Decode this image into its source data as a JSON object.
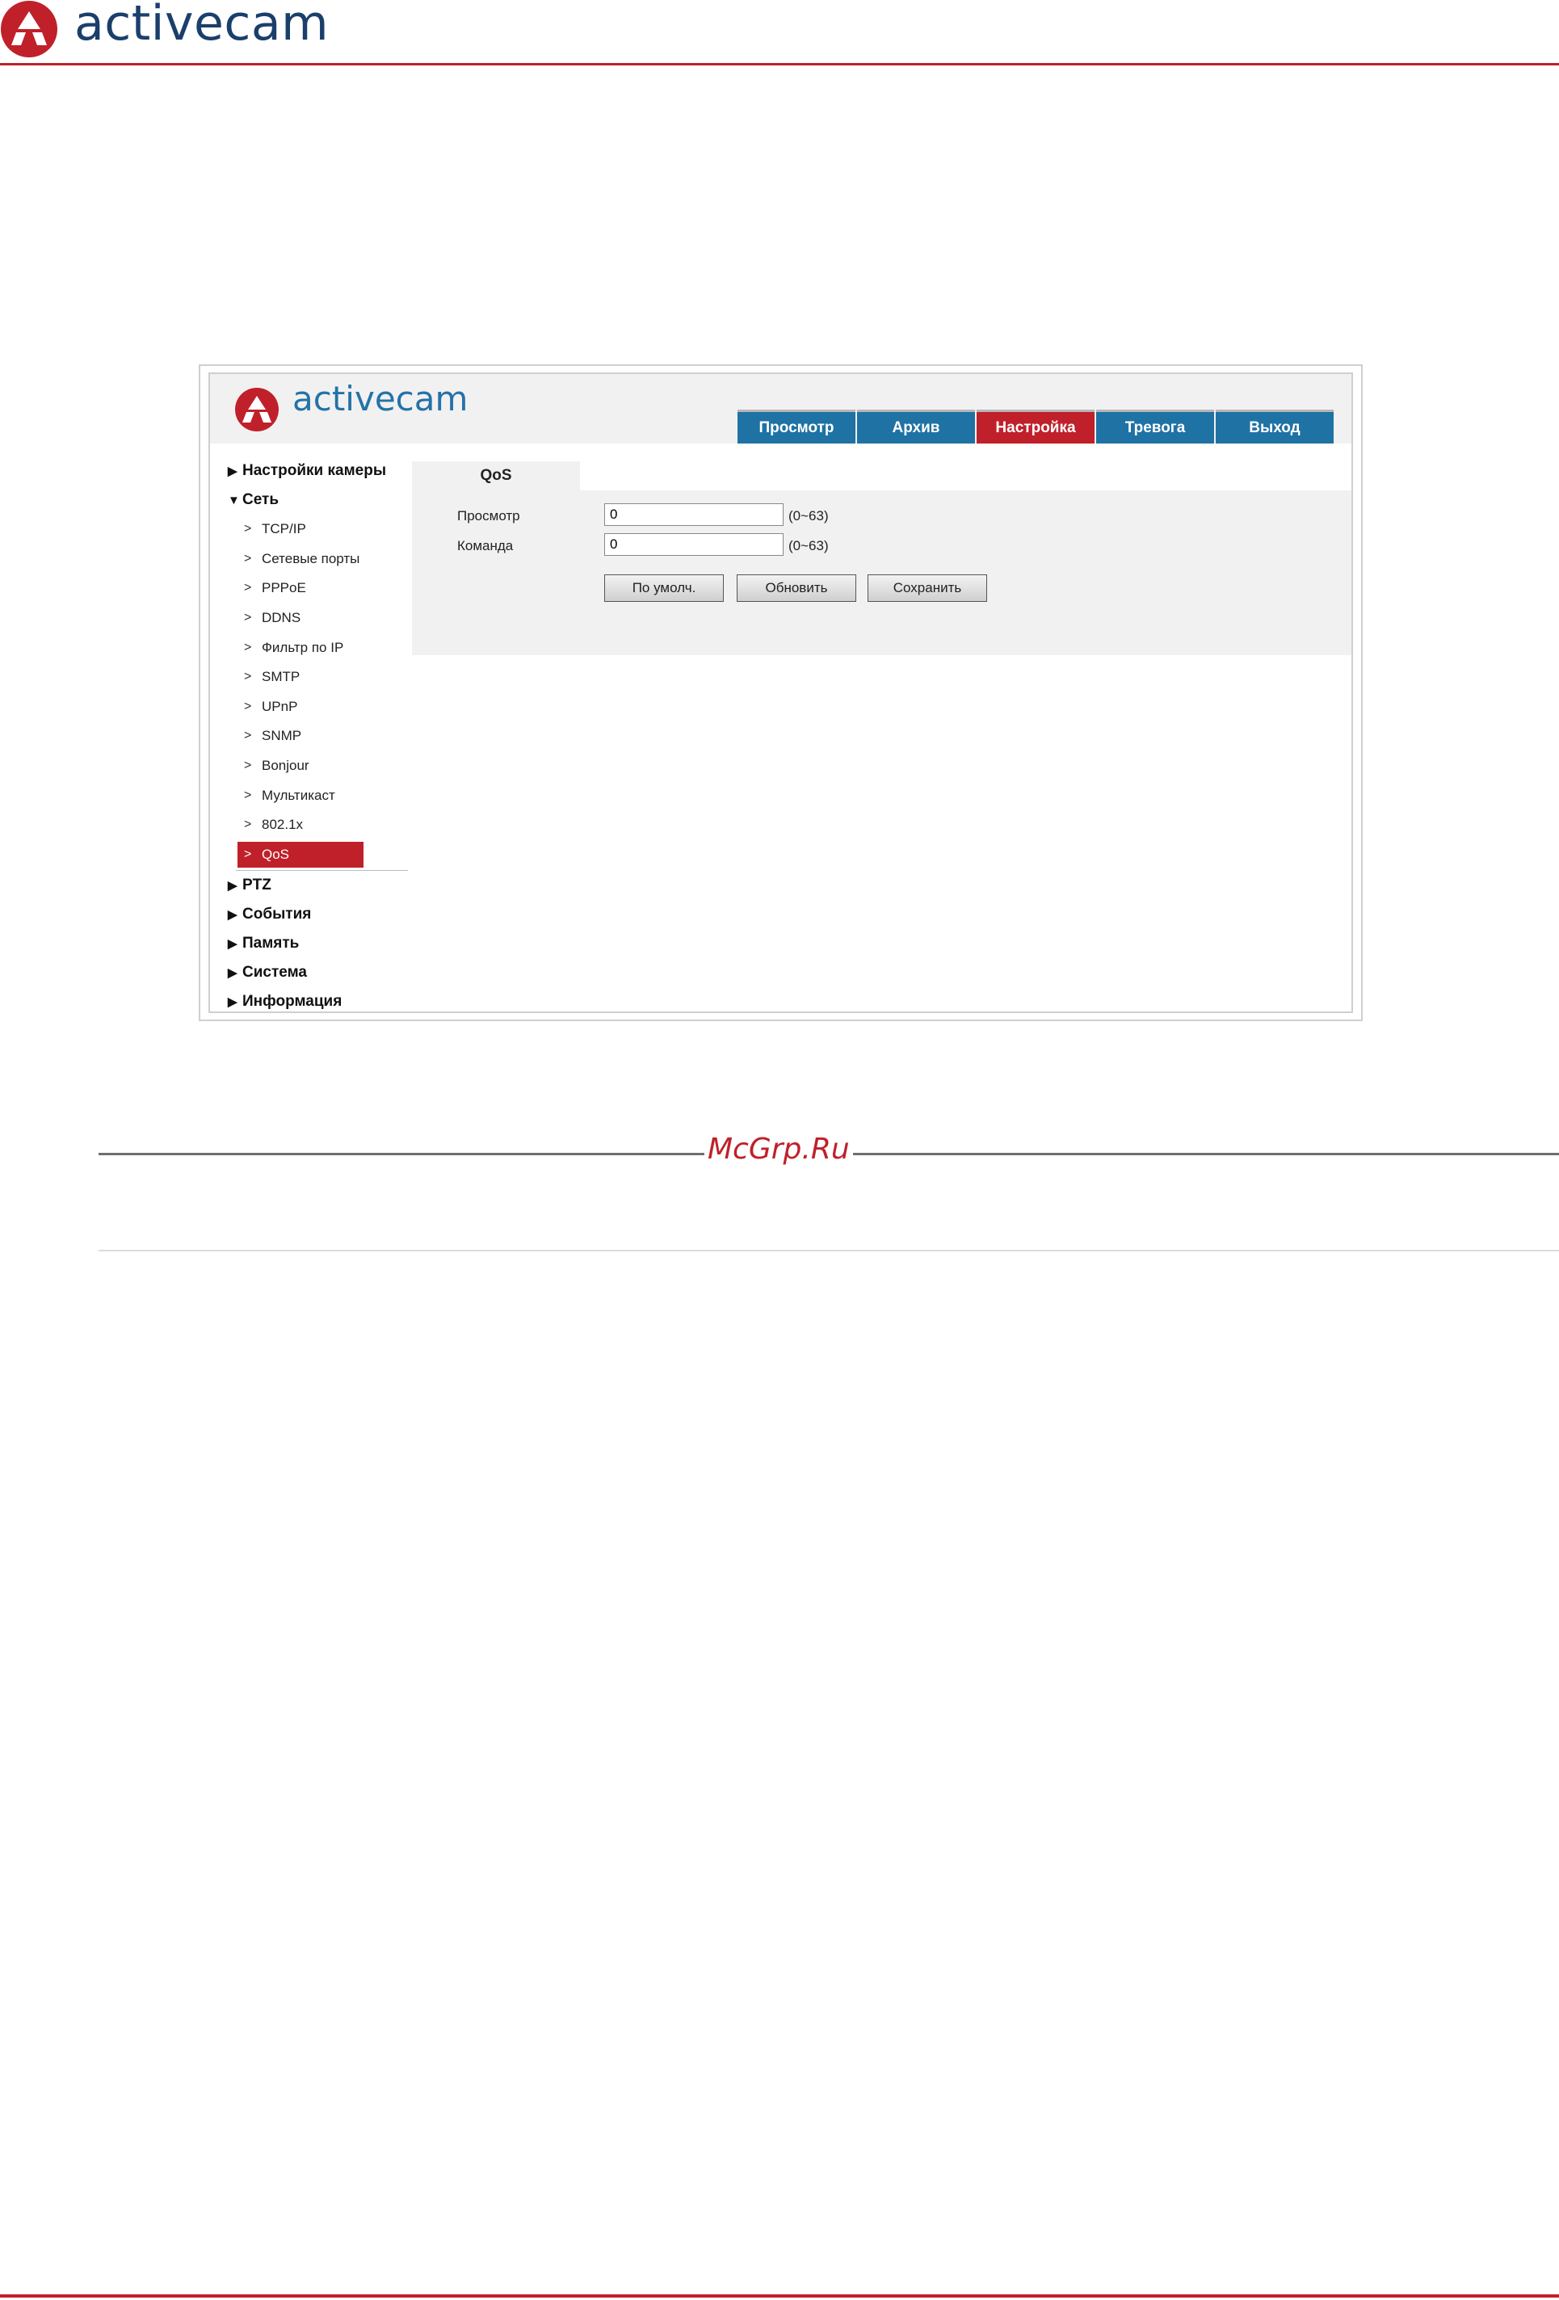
{
  "page": {
    "logo_text": "activecam",
    "watermark": "McGrp.Ru"
  },
  "app": {
    "logo_text": "activecam",
    "tabs": [
      {
        "label": "Просмотр"
      },
      {
        "label": "Архив"
      },
      {
        "label": "Настройка",
        "active": true
      },
      {
        "label": "Тревога"
      },
      {
        "label": "Выход"
      }
    ],
    "sidebar": {
      "sections": [
        {
          "label": "Настройки камеры",
          "expanded": false
        },
        {
          "label": "Сеть",
          "expanded": true
        },
        {
          "label": "PTZ",
          "expanded": false
        },
        {
          "label": "События",
          "expanded": false
        },
        {
          "label": "Память",
          "expanded": false
        },
        {
          "label": "Система",
          "expanded": false
        },
        {
          "label": "Информация",
          "expanded": false
        }
      ],
      "network_items": [
        "TCP/IP",
        "Сетевые порты",
        "PPPoE",
        "DDNS",
        "Фильтр по IP",
        "SMTP",
        "UPnP",
        "SNMP",
        "Bonjour",
        "Мультикаст",
        "802.1x",
        "QoS"
      ],
      "active_item": "QoS"
    },
    "content": {
      "tab_label": "QoS",
      "fields": [
        {
          "label": "Просмотр",
          "value": "0",
          "range": "(0~63)"
        },
        {
          "label": "Команда",
          "value": "0",
          "range": "(0~63)"
        }
      ],
      "buttons": {
        "default": "По умолч.",
        "refresh": "Обновить",
        "save": "Сохранить"
      }
    }
  },
  "colors": {
    "brand_red": "#c0202a",
    "tab_blue": "#1f72a4",
    "logo_navy": "#1a3f6b"
  }
}
